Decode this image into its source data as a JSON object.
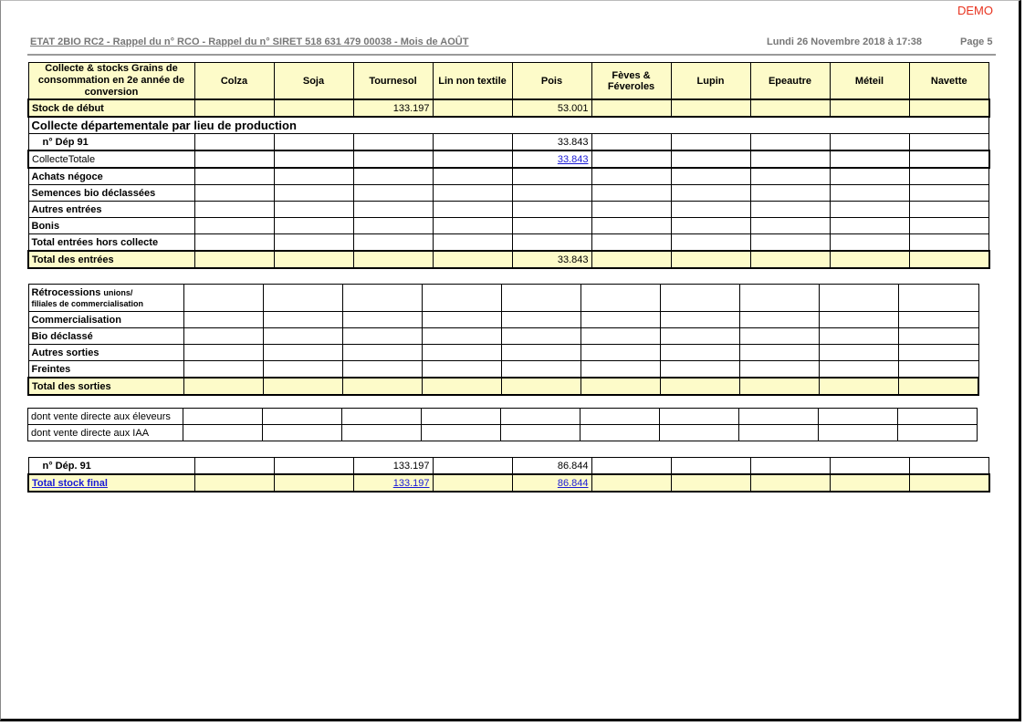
{
  "demo_label": "DEMO",
  "header": {
    "title": "ETAT 2BIO RC2  -  Rappel du n° RCO  - Rappel du n° SIRET 518 631 479 00038 -  Mois de AOÛT",
    "date": "Lundi 26 Novembre 2018 à 17:38",
    "page": "Page 5"
  },
  "table": {
    "corner_label": "Collecte & stocks Grains de consommation en 2e année de conversion",
    "columns": [
      "Colza",
      "Soja",
      "Tournesol",
      "Lin non textile",
      "Pois",
      "Fèves & Féveroles",
      "Lupin",
      "Epeautre",
      "Méteil",
      "Navette"
    ],
    "stock_debut": {
      "label": "Stock de début",
      "values": [
        "",
        "",
        "133.197",
        "",
        "53.001",
        "",
        "",
        "",
        "",
        ""
      ]
    },
    "section_title": "Collecte départementale par lieu de production",
    "dep_row": {
      "label": "n° Dép 91",
      "values": [
        "",
        "",
        "",
        "",
        "33.843",
        "",
        "",
        "",
        "",
        ""
      ]
    },
    "collecte_totale": {
      "label": "CollecteTotale",
      "values": [
        "",
        "",
        "",
        "",
        "33.843",
        "",
        "",
        "",
        "",
        ""
      ]
    },
    "entries": [
      {
        "label": "Achats négoce"
      },
      {
        "label": "Semences bio déclassées"
      },
      {
        "label": "Autres entrées"
      },
      {
        "label": "Bonis"
      },
      {
        "label": "Total entrées hors collecte"
      }
    ],
    "total_entrees": {
      "label": "Total des entrées",
      "values": [
        "",
        "",
        "",
        "",
        "33.843",
        "",
        "",
        "",
        "",
        ""
      ]
    },
    "retro_label": "Rétrocessions",
    "retro_sub1": "unions/",
    "retro_sub2": "filiales de commercialisation",
    "sorties": [
      {
        "label": "Commercialisation"
      },
      {
        "label": "Bio déclassé"
      },
      {
        "label": "Autres sorties"
      },
      {
        "label": "Freintes"
      }
    ],
    "total_sorties": {
      "label": "Total des sorties"
    },
    "dont": [
      {
        "label": "dont vente directe aux éleveurs"
      },
      {
        "label": "dont vente directe aux IAA"
      }
    ],
    "dep_final": {
      "label": "n° Dép. 91",
      "values": [
        "",
        "",
        "133.197",
        "",
        "86.844",
        "",
        "",
        "",
        "",
        ""
      ]
    },
    "total_stock_final": {
      "label": "Total stock final",
      "values": [
        "",
        "",
        "133.197",
        "",
        "86.844",
        "",
        "",
        "",
        "",
        ""
      ]
    }
  }
}
